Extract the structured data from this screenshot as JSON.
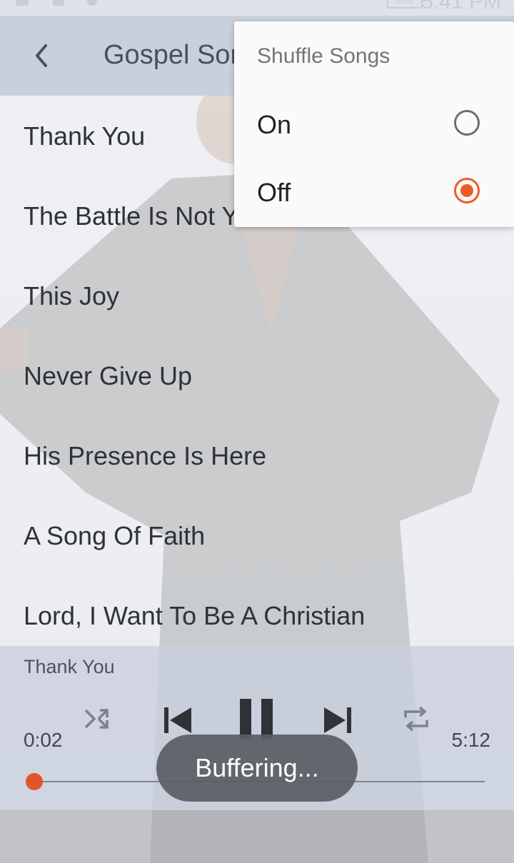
{
  "status_bar": {
    "time": "5:41 PM",
    "battery": "88%"
  },
  "toolbar": {
    "title": "Gospel Songs"
  },
  "songs": [
    "Thank You",
    "The Battle Is Not Yours",
    "This Joy",
    "Never Give Up",
    "His Presence Is Here",
    "A Song Of Faith",
    "Lord, I Want To Be A Christian"
  ],
  "player": {
    "now_playing": "Thank You",
    "elapsed": "0:02",
    "duration": "5:12",
    "progress": 0.006,
    "toast": "Buffering..."
  },
  "shuffle_popup": {
    "title": "Shuffle Songs",
    "options": [
      {
        "label": "On",
        "selected": false
      },
      {
        "label": "Off",
        "selected": true
      }
    ]
  },
  "colors": {
    "accent": "#f05a24",
    "toolbar": "#c9d0dd"
  },
  "icons": [
    "back-arrow-icon",
    "shuffle-icon",
    "skip-previous-icon",
    "pause-icon",
    "skip-next-icon",
    "repeat-icon"
  ]
}
